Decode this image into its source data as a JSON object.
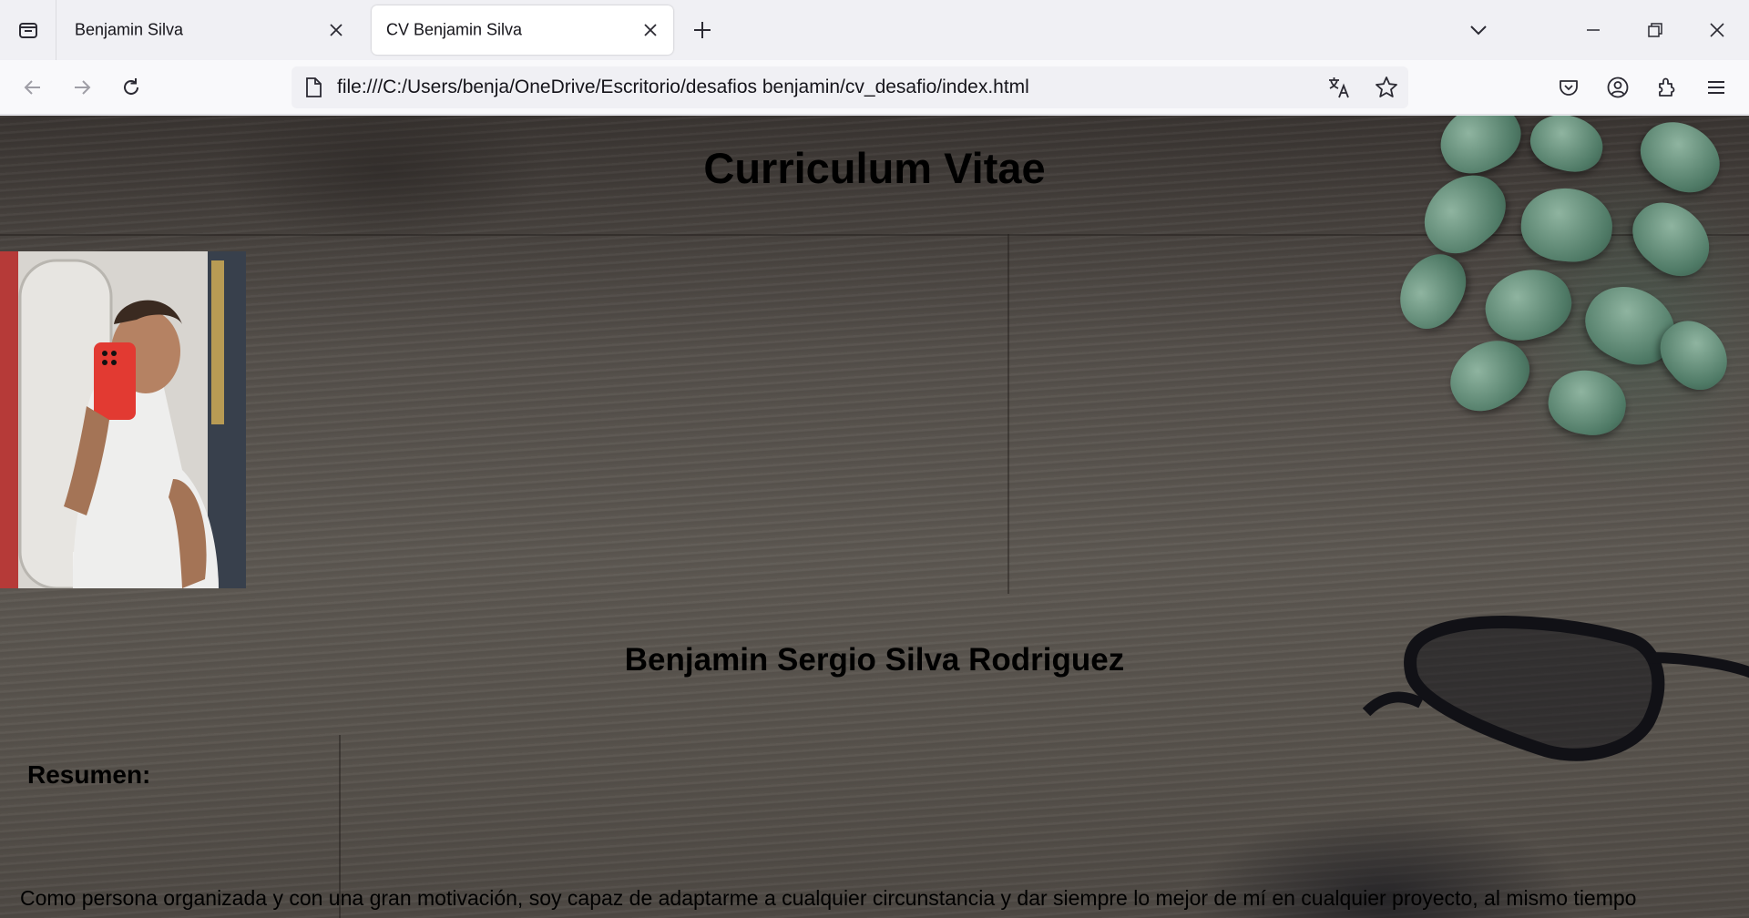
{
  "browser": {
    "tabs": [
      {
        "title": "Benjamin Silva",
        "active": false
      },
      {
        "title": "CV Benjamin Silva",
        "active": true
      }
    ],
    "url": "file:///C:/Users/benja/OneDrive/Escritorio/desafios benjamin/cv_desafio/index.html",
    "icons": {
      "tab_list": "tab-list-icon",
      "close": "close-icon",
      "new_tab": "plus-icon",
      "list_all_tabs": "chevron-down-icon",
      "minimize": "minimize-icon",
      "restore": "restore-icon",
      "window_close": "close-icon",
      "back": "back-arrow-icon",
      "forward": "forward-arrow-icon",
      "reload": "reload-icon",
      "page": "file-icon",
      "translate": "translate-icon",
      "bookmark": "star-icon",
      "pocket": "pocket-icon",
      "account": "account-icon",
      "extensions": "puzzle-icon",
      "menu": "hamburger-menu-icon"
    }
  },
  "page": {
    "title": "Curriculum Vitae",
    "full_name": "Benjamin Sergio Silva Rodriguez",
    "summary_heading": "Resumen:",
    "summary_text": "Como persona organizada y con una gran motivación, soy capaz de adaptarme a cualquier circunstancia y dar siempre lo mejor de mí en cualquier proyecto, al mismo tiempo"
  },
  "colors": {
    "tabstrip_bg": "#f0f0f4",
    "navbar_bg": "#f9f9fb",
    "text": "#000000"
  }
}
